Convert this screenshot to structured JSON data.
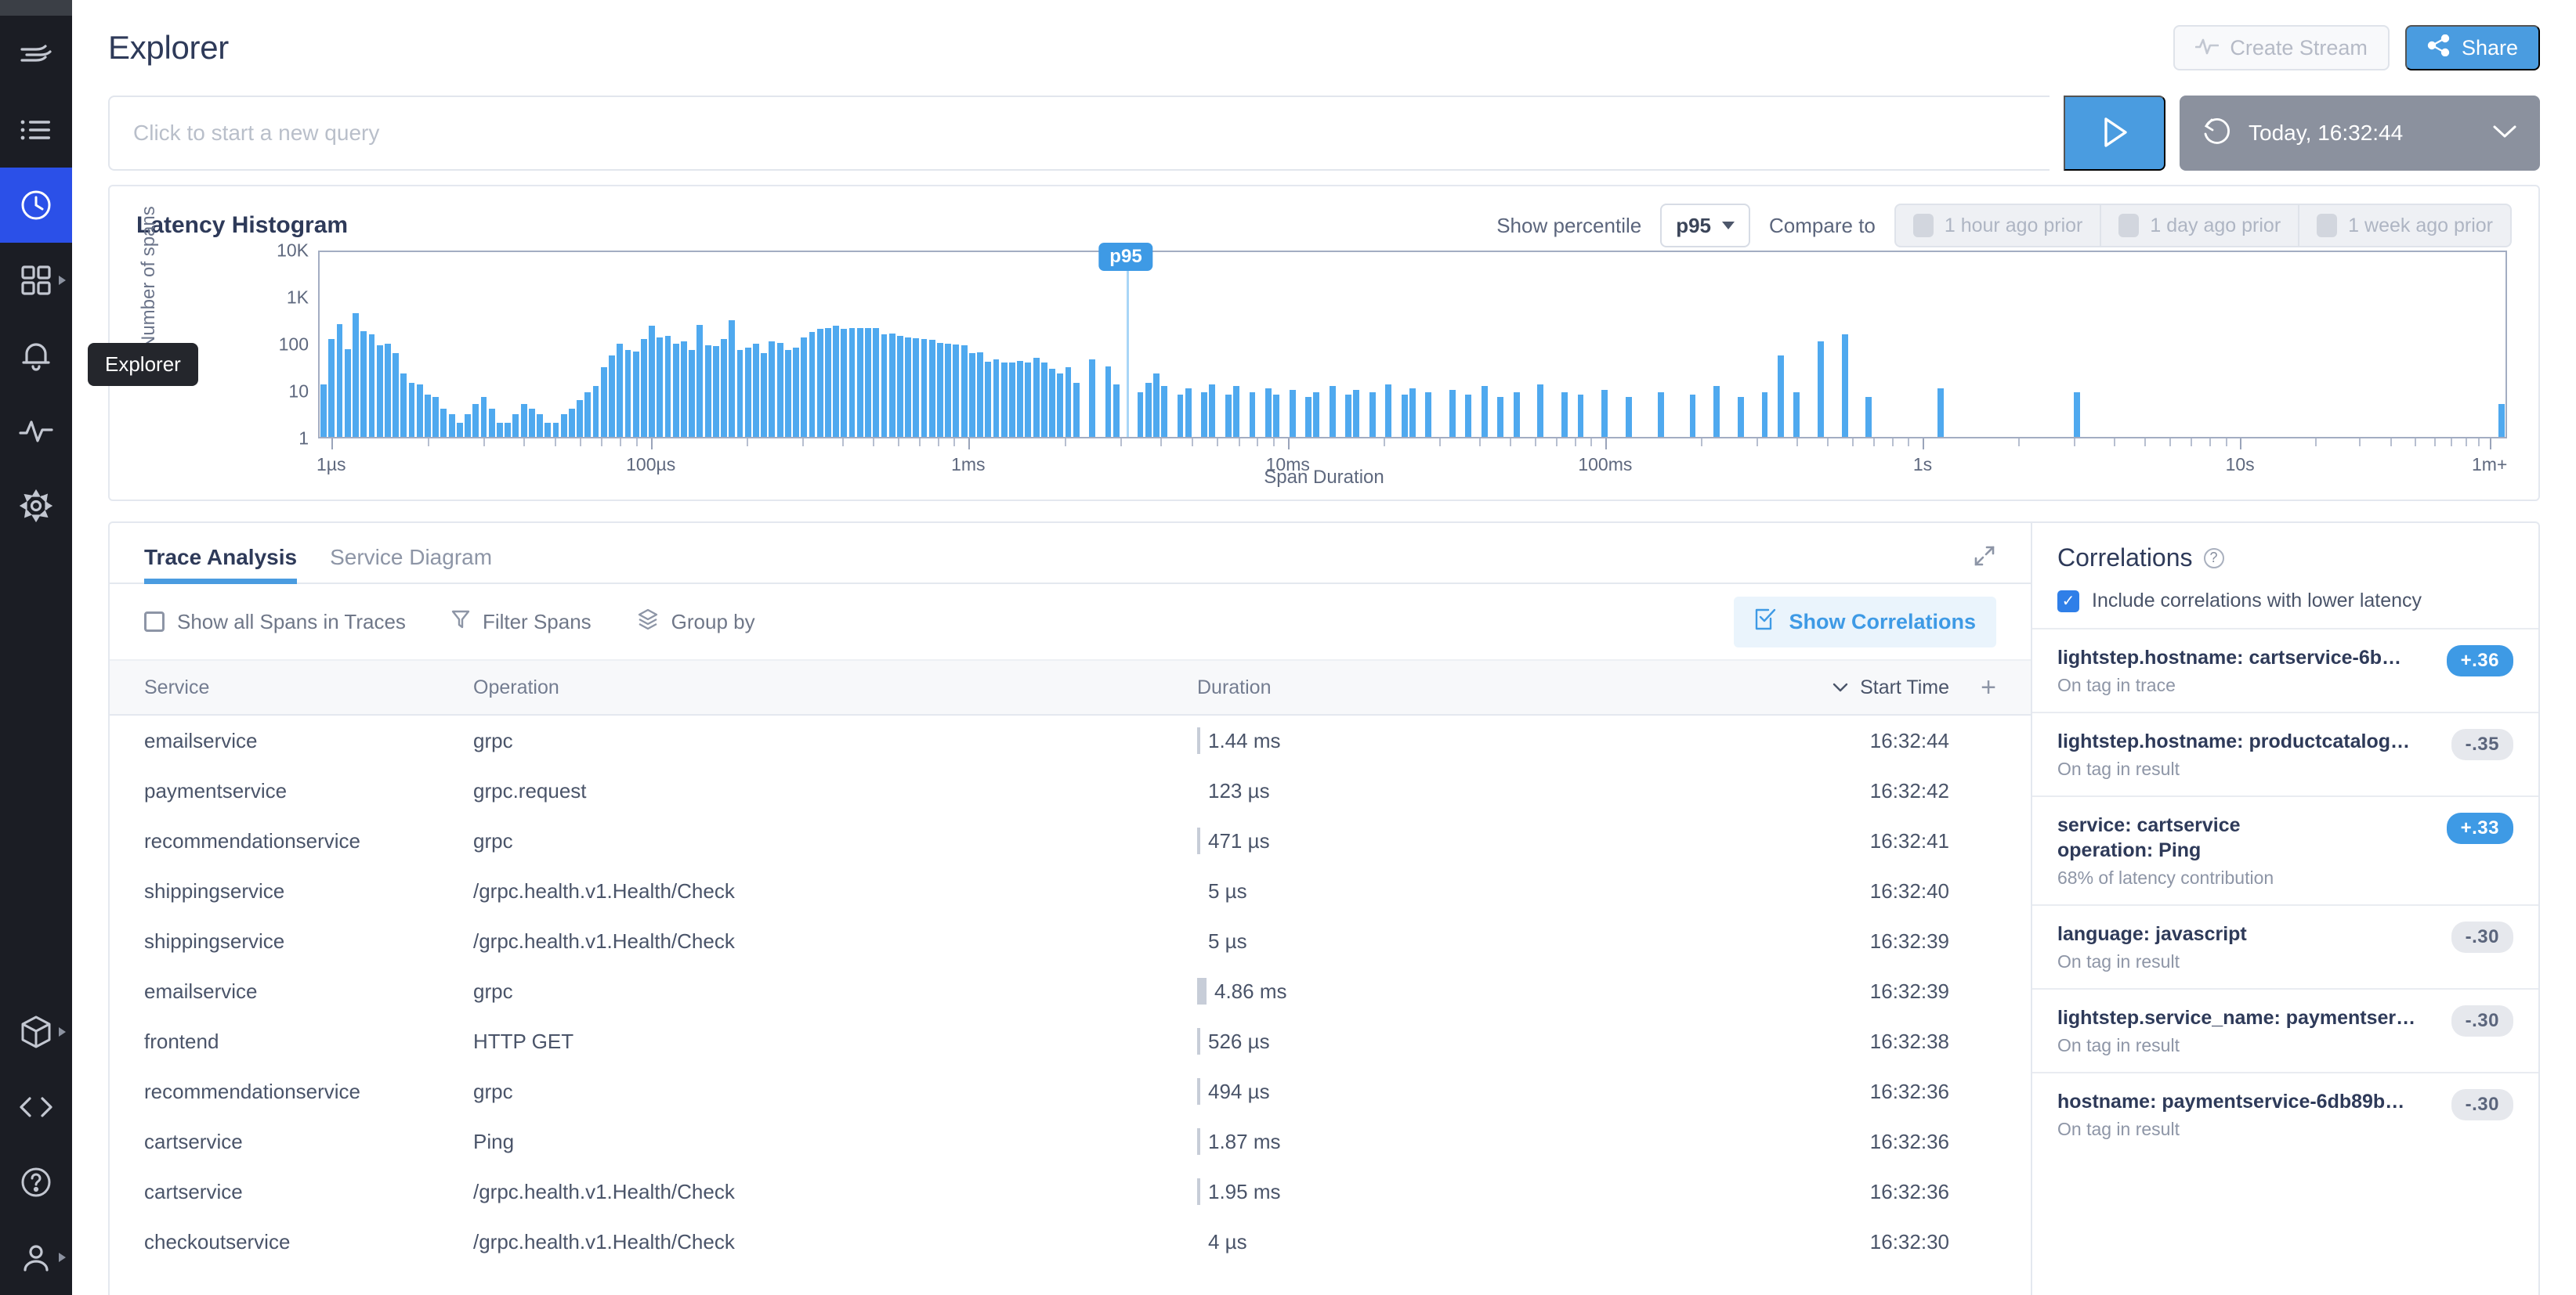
{
  "rail": {
    "items": [
      {
        "name": "logo",
        "icon": "lightstep-logo",
        "active": false,
        "caret": false
      },
      {
        "name": "list",
        "icon": "list-icon",
        "active": false,
        "caret": false
      },
      {
        "name": "explorer",
        "icon": "clock-icon",
        "active": true,
        "caret": false
      },
      {
        "name": "dashboards",
        "icon": "grid-icon",
        "active": false,
        "caret": true
      },
      {
        "name": "alerts",
        "icon": "bell-icon",
        "active": false,
        "caret": false
      },
      {
        "name": "metrics",
        "icon": "pulse-icon",
        "active": false,
        "caret": false
      },
      {
        "name": "settings",
        "icon": "gear-icon",
        "active": false,
        "caret": false
      },
      {
        "name": "packages",
        "icon": "box-icon",
        "active": false,
        "caret": true
      },
      {
        "name": "developer",
        "icon": "code-icon",
        "active": false,
        "caret": false
      },
      {
        "name": "help",
        "icon": "question-icon",
        "active": false,
        "caret": false
      },
      {
        "name": "account",
        "icon": "user-icon",
        "active": false,
        "caret": true
      }
    ],
    "tooltip": "Explorer"
  },
  "header": {
    "title": "Explorer",
    "create_stream_label": "Create Stream",
    "share_label": "Share"
  },
  "query": {
    "placeholder": "Click to start a new query",
    "value": "",
    "run_label": "Run",
    "time_range": "Today, 16:32:44"
  },
  "histogram": {
    "title": "Latency Histogram",
    "show_percentile_label": "Show percentile",
    "percentile_value": "p95",
    "compare_to_label": "Compare to",
    "compare_options": [
      "1 hour ago prior",
      "1 day ago prior",
      "1 week ago prior"
    ],
    "marker_label": "p95"
  },
  "chart_data": {
    "type": "bar",
    "title": "Latency Histogram",
    "xlabel": "Span Duration",
    "ylabel": "Number of spans",
    "yscale": "log",
    "ylim": [
      1,
      10000
    ],
    "ytick_labels": [
      "10K",
      "1K",
      "100",
      "10",
      "1"
    ],
    "ytick_values": [
      10000,
      1000,
      100,
      10,
      1
    ],
    "xtick_labels": [
      "1µs",
      "100µs",
      "1ms",
      "10ms",
      "100ms",
      "1s",
      "10s",
      "1m+"
    ],
    "xtick_positions_pct": [
      0.6,
      15.2,
      29.7,
      44.3,
      58.8,
      73.3,
      87.8,
      99.2
    ],
    "grid": false,
    "legend": "none",
    "marker": {
      "label": "p95",
      "position_pct": 36.9
    },
    "bar_color": "#4fa9ef",
    "values": [
      13,
      120,
      250,
      75,
      430,
      180,
      150,
      90,
      95,
      60,
      22,
      14,
      13,
      8,
      7,
      4,
      3,
      2,
      3,
      5,
      7,
      4,
      2,
      2,
      3,
      5,
      4,
      3,
      2,
      2,
      3,
      4,
      6,
      9,
      12,
      30,
      55,
      95,
      70,
      65,
      120,
      230,
      130,
      140,
      95,
      110,
      70,
      240,
      90,
      85,
      120,
      300,
      70,
      80,
      95,
      60,
      110,
      100,
      70,
      80,
      130,
      170,
      200,
      210,
      230,
      200,
      210,
      205,
      205,
      210,
      150,
      160,
      140,
      130,
      125,
      120,
      115,
      100,
      95,
      92,
      90,
      60,
      62,
      40,
      45,
      38,
      38,
      42,
      38,
      48,
      38,
      28,
      22,
      30,
      14,
      0,
      45,
      0,
      32,
      13,
      0,
      0,
      9,
      14,
      22,
      12,
      0,
      8,
      11,
      0,
      9,
      13,
      0,
      8,
      12,
      0,
      9,
      0,
      11,
      8,
      0,
      10,
      0,
      7,
      9,
      0,
      12,
      0,
      8,
      10,
      0,
      9,
      0,
      13,
      0,
      8,
      11,
      0,
      9,
      0,
      0,
      10,
      0,
      8,
      0,
      12,
      0,
      7,
      0,
      9,
      0,
      0,
      13,
      0,
      0,
      9,
      0,
      8,
      0,
      0,
      10,
      0,
      0,
      7,
      0,
      0,
      0,
      9,
      0,
      0,
      0,
      8,
      0,
      0,
      12,
      0,
      0,
      7,
      0,
      0,
      9,
      0,
      55,
      0,
      9,
      0,
      0,
      110,
      0,
      0,
      150,
      0,
      0,
      7,
      0,
      0,
      0,
      0,
      0,
      0,
      0,
      0,
      11,
      0,
      0,
      0,
      0,
      0,
      0,
      0,
      0,
      0,
      0,
      0,
      0,
      0,
      0,
      0,
      0,
      9,
      0,
      0,
      0,
      0,
      0,
      0,
      0,
      0,
      0,
      0,
      0,
      0,
      0,
      0,
      0,
      0,
      0,
      0,
      0,
      0,
      0,
      0,
      0,
      0,
      0,
      0,
      0,
      0,
      0,
      0,
      0,
      0,
      0,
      0,
      0,
      0,
      0,
      0,
      0,
      0,
      0,
      0,
      0,
      0,
      0,
      0,
      0,
      0,
      0,
      0,
      0,
      0,
      5
    ]
  },
  "tabs": [
    {
      "label": "Trace Analysis",
      "active": true
    },
    {
      "label": "Service Diagram",
      "active": false
    }
  ],
  "toolbar": {
    "show_all_spans_label": "Show all Spans in Traces",
    "filter_spans_label": "Filter Spans",
    "group_by_label": "Group by",
    "show_correlations_label": "Show Correlations"
  },
  "table": {
    "columns": [
      "Service",
      "Operation",
      "Duration",
      "Start Time"
    ],
    "sort_column": "Start Time",
    "sort_direction": "desc",
    "add_column_label": "+",
    "rows": [
      {
        "service": "emailservice",
        "operation": "grpc",
        "duration": "1.44 ms",
        "start_time": "16:32:44",
        "bar": "thin"
      },
      {
        "service": "paymentservice",
        "operation": "grpc.request",
        "duration": "123 µs",
        "start_time": "16:32:42",
        "bar": "none"
      },
      {
        "service": "recommendationservice",
        "operation": "grpc",
        "duration": "471 µs",
        "start_time": "16:32:41",
        "bar": "thin"
      },
      {
        "service": "shippingservice",
        "operation": "/grpc.health.v1.Health/Check",
        "duration": "5 µs",
        "start_time": "16:32:40",
        "bar": "none"
      },
      {
        "service": "shippingservice",
        "operation": "/grpc.health.v1.Health/Check",
        "duration": "5 µs",
        "start_time": "16:32:39",
        "bar": "none"
      },
      {
        "service": "emailservice",
        "operation": "grpc",
        "duration": "4.86 ms",
        "start_time": "16:32:39",
        "bar": "wide"
      },
      {
        "service": "frontend",
        "operation": "HTTP GET",
        "duration": "526 µs",
        "start_time": "16:32:38",
        "bar": "thin"
      },
      {
        "service": "recommendationservice",
        "operation": "grpc",
        "duration": "494 µs",
        "start_time": "16:32:36",
        "bar": "thin"
      },
      {
        "service": "cartservice",
        "operation": "Ping",
        "duration": "1.87 ms",
        "start_time": "16:32:36",
        "bar": "thin"
      },
      {
        "service": "cartservice",
        "operation": "/grpc.health.v1.Health/Check",
        "duration": "1.95 ms",
        "start_time": "16:32:36",
        "bar": "thin"
      },
      {
        "service": "checkoutservice",
        "operation": "/grpc.health.v1.Health/Check",
        "duration": "4 µs",
        "start_time": "16:32:30",
        "bar": "none"
      }
    ]
  },
  "correlations": {
    "title": "Correlations",
    "include_lower_latency_label": "Include correlations with lower latency",
    "include_lower_latency_checked": true,
    "items": [
      {
        "main": "lightstep.hostname: cartservice-6b…",
        "sub": "On tag in trace",
        "score": "+.36",
        "positive": true
      },
      {
        "main": "lightstep.hostname: productcatalog…",
        "sub": "On tag in result",
        "score": "-.35",
        "positive": false
      },
      {
        "main": "service: cartservice\noperation: Ping",
        "sub": "68% of latency contribution",
        "score": "+.33",
        "positive": true
      },
      {
        "main": "language: javascript",
        "sub": "On tag in result",
        "score": "-.30",
        "positive": false
      },
      {
        "main": "lightstep.service_name: paymentser…",
        "sub": "On tag in result",
        "score": "-.30",
        "positive": false
      },
      {
        "main": "hostname: paymentservice-6db89b…",
        "sub": "On tag in result",
        "score": "-.30",
        "positive": false
      }
    ]
  },
  "colors": {
    "accent_blue": "#4a9ce0",
    "rail_active": "#2b50e8",
    "bar_blue": "#4fa9ef",
    "text_dark": "#2e3a59"
  }
}
